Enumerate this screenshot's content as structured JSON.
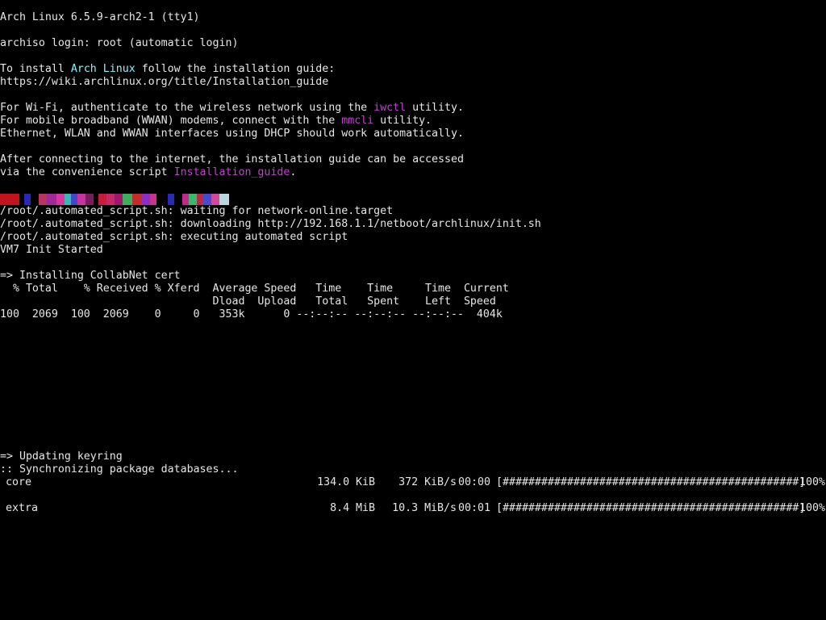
{
  "terminal": {
    "header": "Arch Linux 6.5.9-arch2-1 (tty1)",
    "login": "archiso login: root (automatic login)",
    "install_prefix": "To install ",
    "install_highlight": "Arch Linux",
    "install_suffix": " follow the installation guide:",
    "install_url": "https://wiki.archlinux.org/title/Installation_guide",
    "wifi_prefix": "For Wi-Fi, authenticate to the wireless network using the ",
    "wifi_highlight": "iwctl",
    "wifi_suffix": " utility.",
    "mobile_prefix": "For mobile broadband (WWAN) modems, connect with the ",
    "mobile_highlight": "mmcli",
    "mobile_suffix": " utility.",
    "ethernet": "Ethernet, WLAN and WWAN interfaces using DHCP should work automatically.",
    "after_connect": "After connecting to the internet, the installation guide can be accessed",
    "via_prefix": "via the convenience script ",
    "via_highlight": "Installation_guide",
    "via_suffix": ".",
    "script_wait": "/root/.automated_script.sh: waiting for network-online.target",
    "script_download": "/root/.automated_script.sh: downloading http://192.168.1.1/netboot/archlinux/init.sh",
    "script_exec": "/root/.automated_script.sh: executing automated script",
    "init_started": "VM7 Init Started",
    "cert_title": "=> Installing CollabNet cert",
    "curl_header1": "  % Total    % Received % Xferd  Average Speed   Time    Time     Time  Current",
    "curl_header2": "                                 Dload  Upload   Total   Spent    Left  Speed",
    "curl_row": "100  2069  100  2069    0     0   353k      0 --:--:-- --:--:-- --:--:--  404k",
    "keyring_title": "=> Updating keyring",
    "sync_title": ":: Synchronizing package databases...",
    "colors": {
      "text": "#e6e6e6",
      "highlight_cyan": "#8ff2ff",
      "highlight_magenta": "#c43dd4",
      "background": "#000000"
    }
  },
  "packages": [
    {
      "name": "core",
      "size": "134.0 KiB",
      "speed": "372 KiB/s",
      "time": "00:00",
      "bar": "[##############################################]",
      "percent": "100%",
      "progress": 1.0
    },
    {
      "name": "extra",
      "size": "8.4 MiB",
      "speed": "10.3 MiB/s",
      "time": "00:01",
      "bar": "[##############################################]",
      "percent": "100%",
      "progress": 1.0
    }
  ]
}
